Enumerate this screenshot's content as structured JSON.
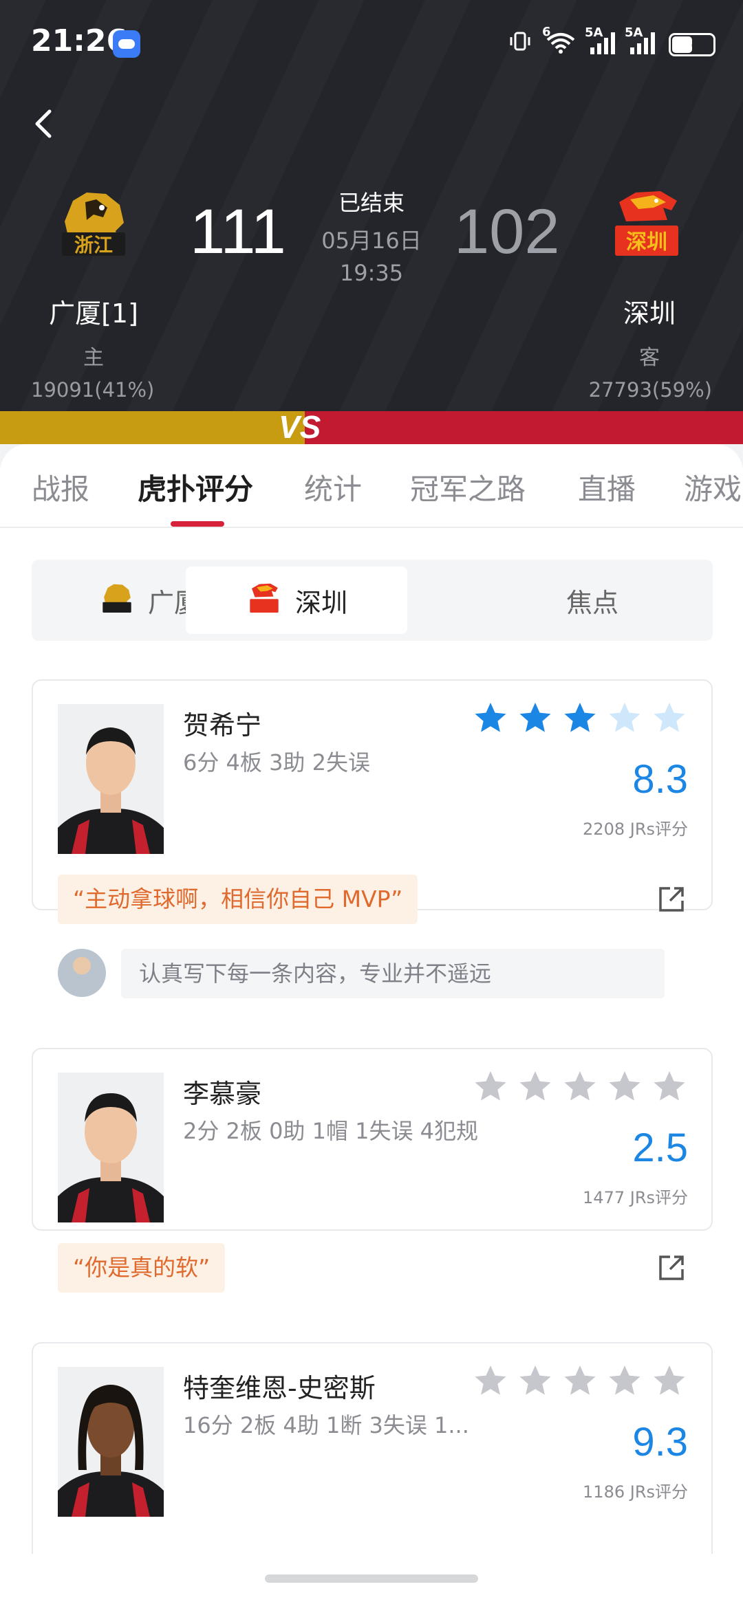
{
  "status_bar": {
    "time": "21:26",
    "network_1": "6",
    "signal_1": "5A",
    "signal_2": "5A",
    "battery": "47"
  },
  "match": {
    "home": {
      "name": "广厦[1]",
      "role": "主",
      "support": "19091(41%)",
      "score": "111",
      "logo_text": "浙江"
    },
    "away": {
      "name": "深圳",
      "role": "客",
      "support": "27793(59%)",
      "score": "102",
      "logo_text": "深圳"
    },
    "status": "已结束",
    "date": "05月16日",
    "time": "19:35",
    "support_split": {
      "home": 0.41,
      "away": 0.59
    },
    "vs_label": "VS"
  },
  "tabs": [
    "战报",
    "虎扑评分",
    "统计",
    "冠军之路",
    "直播",
    "游戏"
  ],
  "active_tab": "虎扑评分",
  "segments": [
    {
      "label": "广厦"
    },
    {
      "label": "深圳"
    },
    {
      "label": "焦点"
    }
  ],
  "active_segment": "深圳",
  "players": [
    {
      "name": "贺希宁",
      "stats": "6分 4板 3助 2失误",
      "rating": "8.3",
      "votes": "2208 JRs评分",
      "stars_filled": 3,
      "quote": "“主动拿球啊，相信你自己 MVP”",
      "comment_placeholder": "认真写下每一条内容，专业并不遥远"
    },
    {
      "name": "李慕豪",
      "stats": "2分 2板 0助 1帽 1失误 4犯规",
      "rating": "2.5",
      "votes": "1477 JRs评分",
      "stars_filled": 0,
      "quote": "“你是真的软”"
    },
    {
      "name": "特奎维恩-史密斯",
      "stats": "16分 2板 4助 1断 3失误 1...",
      "rating": "9.3",
      "votes": "1186 JRs评分",
      "stars_filled": 0
    }
  ],
  "colors": {
    "header_bg": "#23252b",
    "home_bar": "#c79c10",
    "away_bar": "#c21a30",
    "accent_red": "#d8213a",
    "rating_blue": "#1b86e3",
    "star_filled": "#1b86e3",
    "star_light": "#b9ddfa",
    "star_gray": "#c5c7cd",
    "quote_text": "#e0692d"
  }
}
